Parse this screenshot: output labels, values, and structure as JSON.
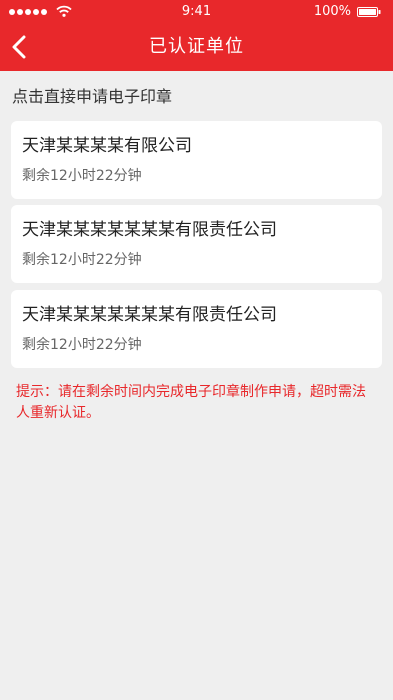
{
  "status_bar": {
    "time": "9:41",
    "battery_pct": "100%",
    "icons": [
      "signal-icon",
      "wifi-icon",
      "battery-icon"
    ]
  },
  "navbar": {
    "back_icon": "chevron-left-icon",
    "title": "已认证单位"
  },
  "section_label": "点击直接申请电子印章",
  "units": [
    {
      "name": "天津某某某某有限公司",
      "remaining": "剩余12小时22分钟"
    },
    {
      "name": "天津某某某某某某某有限责任公司",
      "remaining": "剩余12小时22分钟"
    },
    {
      "name": "天津某某某某某某某有限责任公司",
      "remaining": "剩余12小时22分钟"
    }
  ],
  "tip": "提示：请在剩余时间内完成电子印章制作申请，超时需法人重新认证。",
  "colors": {
    "brand_red": "#e8282b",
    "background": "#efefef",
    "card": "#ffffff"
  }
}
